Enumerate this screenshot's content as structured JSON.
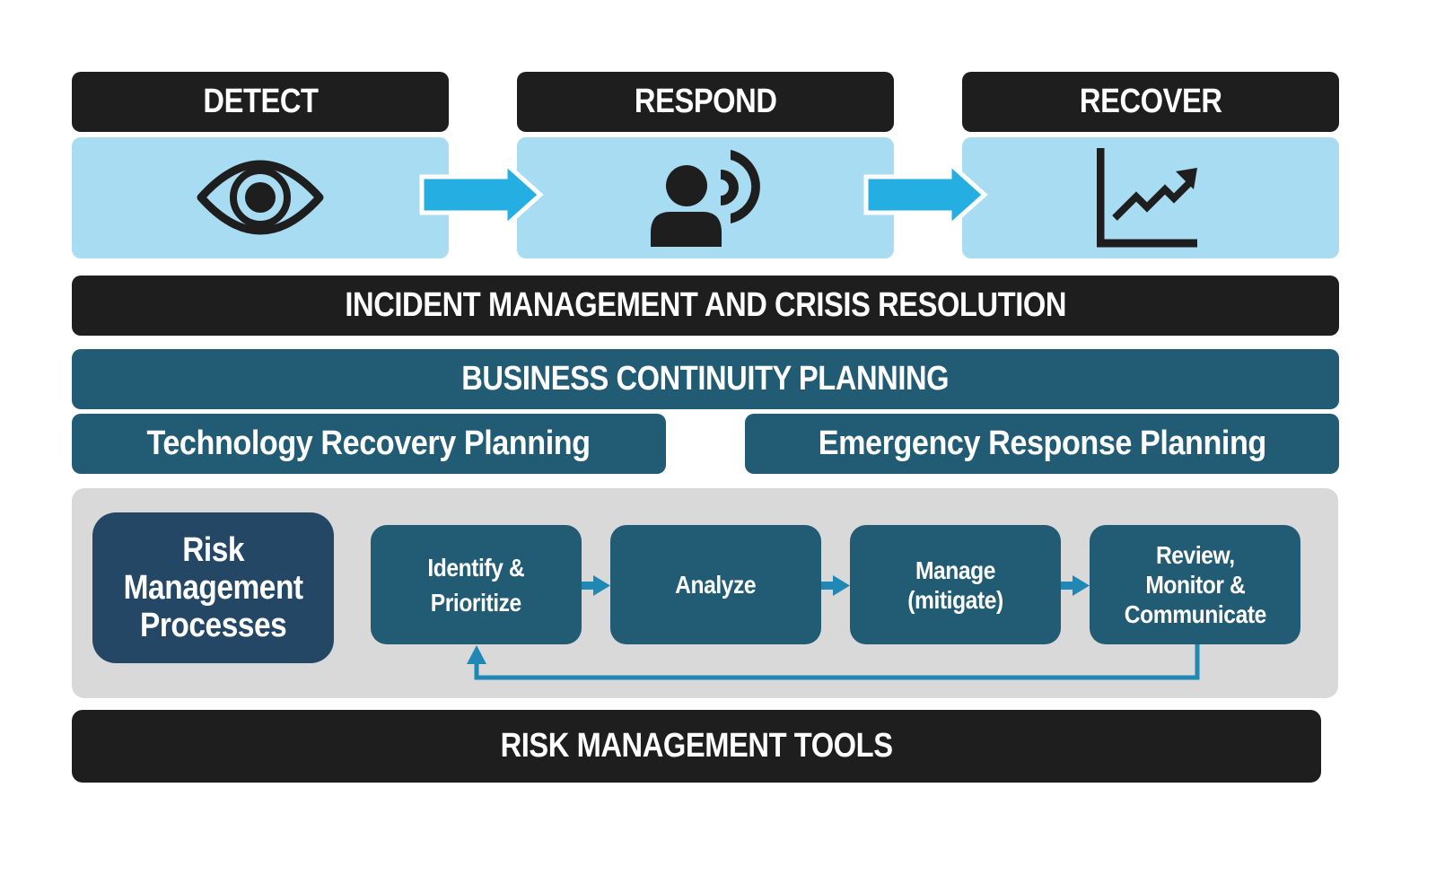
{
  "phases": [
    {
      "label": "DETECT",
      "icon": "eye-icon"
    },
    {
      "label": "RESPOND",
      "icon": "person-speaking-icon"
    },
    {
      "label": "RECOVER",
      "icon": "growth-chart-icon"
    }
  ],
  "incident_bar": {
    "label": "INCIDENT MANAGEMENT AND CRISIS RESOLUTION"
  },
  "bcp_bar": {
    "label": "BUSINESS CONTINUITY PLANNING"
  },
  "planning": [
    {
      "label": "Technology Recovery Planning"
    },
    {
      "label": "Emergency Response Planning"
    }
  ],
  "risk_processes": {
    "title_lines": [
      "Risk",
      "Management",
      "Processes"
    ],
    "steps": [
      {
        "lines": [
          "Identify &",
          "Prioritize"
        ]
      },
      {
        "lines": [
          "Analyze"
        ]
      },
      {
        "lines": [
          "Manage",
          "(mitigate)"
        ]
      },
      {
        "lines": [
          "Review,",
          "Monitor &",
          "Communicate"
        ]
      }
    ],
    "loop_back": {
      "from": "Review, Monitor & Communicate",
      "to": "Identify & Prioritize"
    }
  },
  "tools_bar": {
    "label": "RISK MANAGEMENT TOOLS"
  },
  "colors": {
    "black": "#1e1e1e",
    "light_blue": "#a8dcf2",
    "arrow_blue": "#24aee2",
    "teal": "#225b74",
    "navy": "#244766",
    "flow_arrow": "#1f88b5",
    "panel_gray": "#d9d9d9"
  }
}
